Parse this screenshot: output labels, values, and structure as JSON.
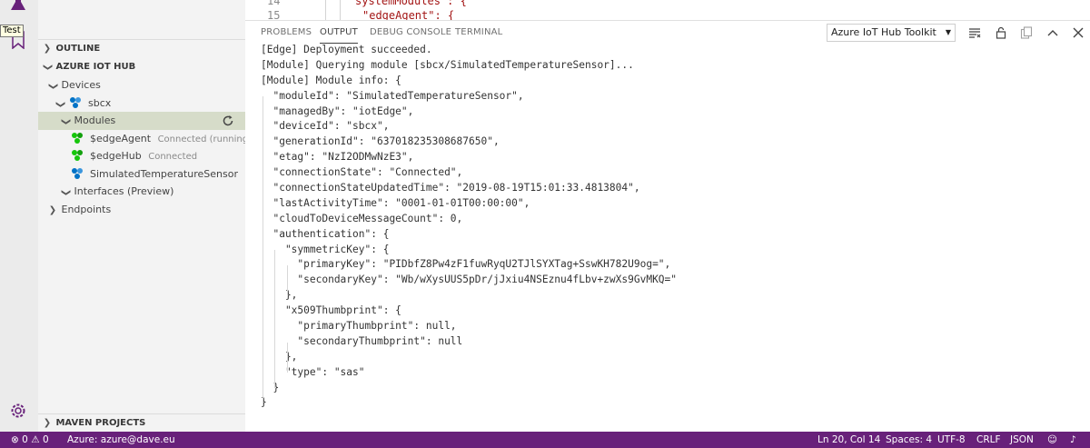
{
  "activity_bar": {
    "test_tooltip": "Test",
    "icons": [
      "flask-icon",
      "bookmark-icon",
      "gear-icon"
    ]
  },
  "sidebar": {
    "outline_header": "OUTLINE",
    "hub_header": "AZURE IOT HUB",
    "devices_label": "Devices",
    "device_name": "sbcx",
    "modules_label": "Modules",
    "modules": [
      {
        "name": "$edgeAgent",
        "status": "Connected (running)",
        "icon": "module-connected-icon"
      },
      {
        "name": "$edgeHub",
        "status": "Connected",
        "icon": "module-connected-icon"
      },
      {
        "name": "SimulatedTemperatureSensor",
        "status": "",
        "icon": "module-icon"
      }
    ],
    "interfaces_label": "Interfaces (Preview)",
    "endpoints_label": "Endpoints",
    "maven_header": "MAVEN PROJECTS"
  },
  "editor": {
    "line_numbers": [
      "14",
      "15"
    ],
    "code_lines": [
      "systemModules\": {",
      "\"edgeAgent\": {"
    ]
  },
  "panel": {
    "tabs": [
      "PROBLEMS",
      "OUTPUT",
      "DEBUG CONSOLE",
      "TERMINAL"
    ],
    "active_tab": "OUTPUT",
    "channel": "Azure IoT Hub Toolkit",
    "output_lines": [
      "[Edge] Deployment succeeded.",
      "[Module] Querying module [sbcx/SimulatedTemperatureSensor]...",
      "[Module] Module info: {",
      "  \"moduleId\": \"SimulatedTemperatureSensor\",",
      "  \"managedBy\": \"iotEdge\",",
      "  \"deviceId\": \"sbcx\",",
      "  \"generationId\": \"637018235308687650\",",
      "  \"etag\": \"NzI2ODMwNzE3\",",
      "  \"connectionState\": \"Connected\",",
      "  \"connectionStateUpdatedTime\": \"2019-08-19T15:01:33.4813804\",",
      "  \"lastActivityTime\": \"0001-01-01T00:00:00\",",
      "  \"cloudToDeviceMessageCount\": 0,",
      "  \"authentication\": {",
      "    \"symmetricKey\": {",
      "      \"primaryKey\": \"PIDbfZ8Pw4zF1fuwRyqU2TJlSYXTag+SswKH782U9og=\",",
      "      \"secondaryKey\": \"Wb/wXysUUS5pDr/jJxiu4NSEznu4fLbv+zwXs9GvMKQ=\"",
      "    },",
      "    \"x509Thumbprint\": {",
      "      \"primaryThumbprint\": null,",
      "      \"secondaryThumbprint\": null",
      "    },",
      "    \"type\": \"sas\"",
      "  }",
      "}"
    ]
  },
  "status_bar": {
    "errors": "0",
    "warnings": "0",
    "account": "Azure: azure@dave.eu",
    "cursor": "Ln 20, Col 14",
    "spaces": "Spaces: 4",
    "encoding": "UTF-8",
    "eol": "CRLF",
    "language": "JSON"
  }
}
